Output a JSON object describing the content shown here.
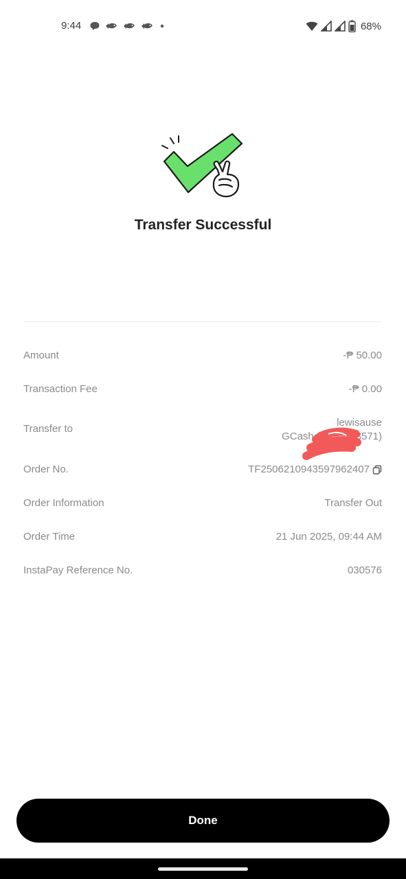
{
  "status_bar": {
    "time": "9:44",
    "battery_percent": "68%",
    "notification_icons": [
      "chat-bubble-icon",
      "game-fish-icon",
      "game-fish-icon",
      "game-fish-icon",
      "dot-icon"
    ],
    "system_icons": [
      "wifi-icon",
      "signal-icon",
      "signal-icon",
      "battery-icon"
    ]
  },
  "hero": {
    "title": "Transfer Successful",
    "illustration": "checkmark-peace-hand-icon",
    "accent_color": "#69e06b"
  },
  "details": [
    {
      "label": "Amount",
      "value": "-₱ 50.00"
    },
    {
      "label": "Transaction Fee",
      "value": "-₱ 0.00"
    },
    {
      "label": "Transfer to",
      "value_lines": [
        "lewisause",
        "GCash (09******8571)"
      ]
    },
    {
      "label": "Order No.",
      "value": "TF2506210943597962407"
    },
    {
      "label": "Order Information",
      "value": "Transfer Out"
    },
    {
      "label": "Order Time",
      "value": "21 Jun 2025, 09:44 AM"
    },
    {
      "label": "InstaPay Reference No.",
      "value": "030576"
    }
  ],
  "footer": {
    "done_label": "Done"
  },
  "colors": {
    "redaction": "#f25a5a",
    "button_bg": "#000000"
  }
}
